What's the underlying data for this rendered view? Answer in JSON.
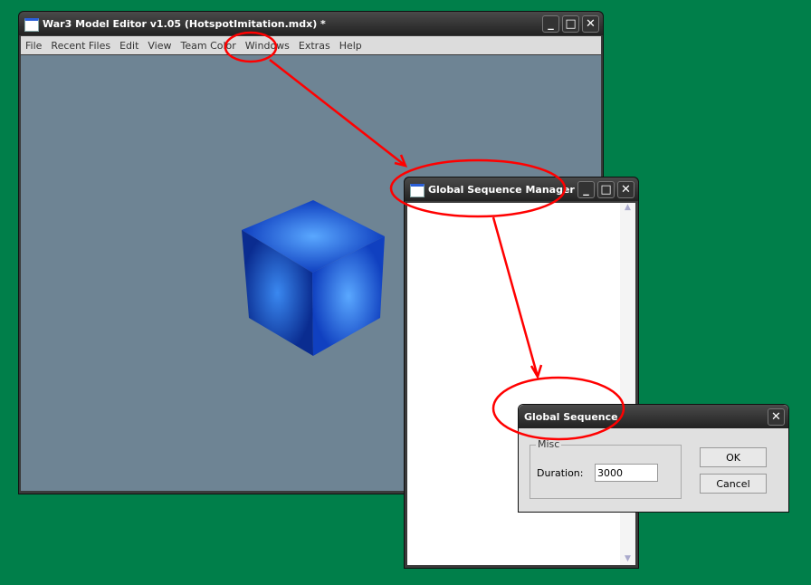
{
  "main_window": {
    "title": "War3 Model Editor v1.05 (HotspotImitation.mdx) *",
    "menu": [
      "File",
      "Recent Files",
      "Edit",
      "View",
      "Team Color",
      "Windows",
      "Extras",
      "Help"
    ]
  },
  "manager_window": {
    "title": "Global Sequence Manager"
  },
  "dialog": {
    "title": "Global Sequence",
    "group": "Misc",
    "duration_label": "Duration:",
    "duration_value": "3000",
    "ok": "OK",
    "cancel": "Cancel"
  },
  "annotation_color": "#ff0000"
}
